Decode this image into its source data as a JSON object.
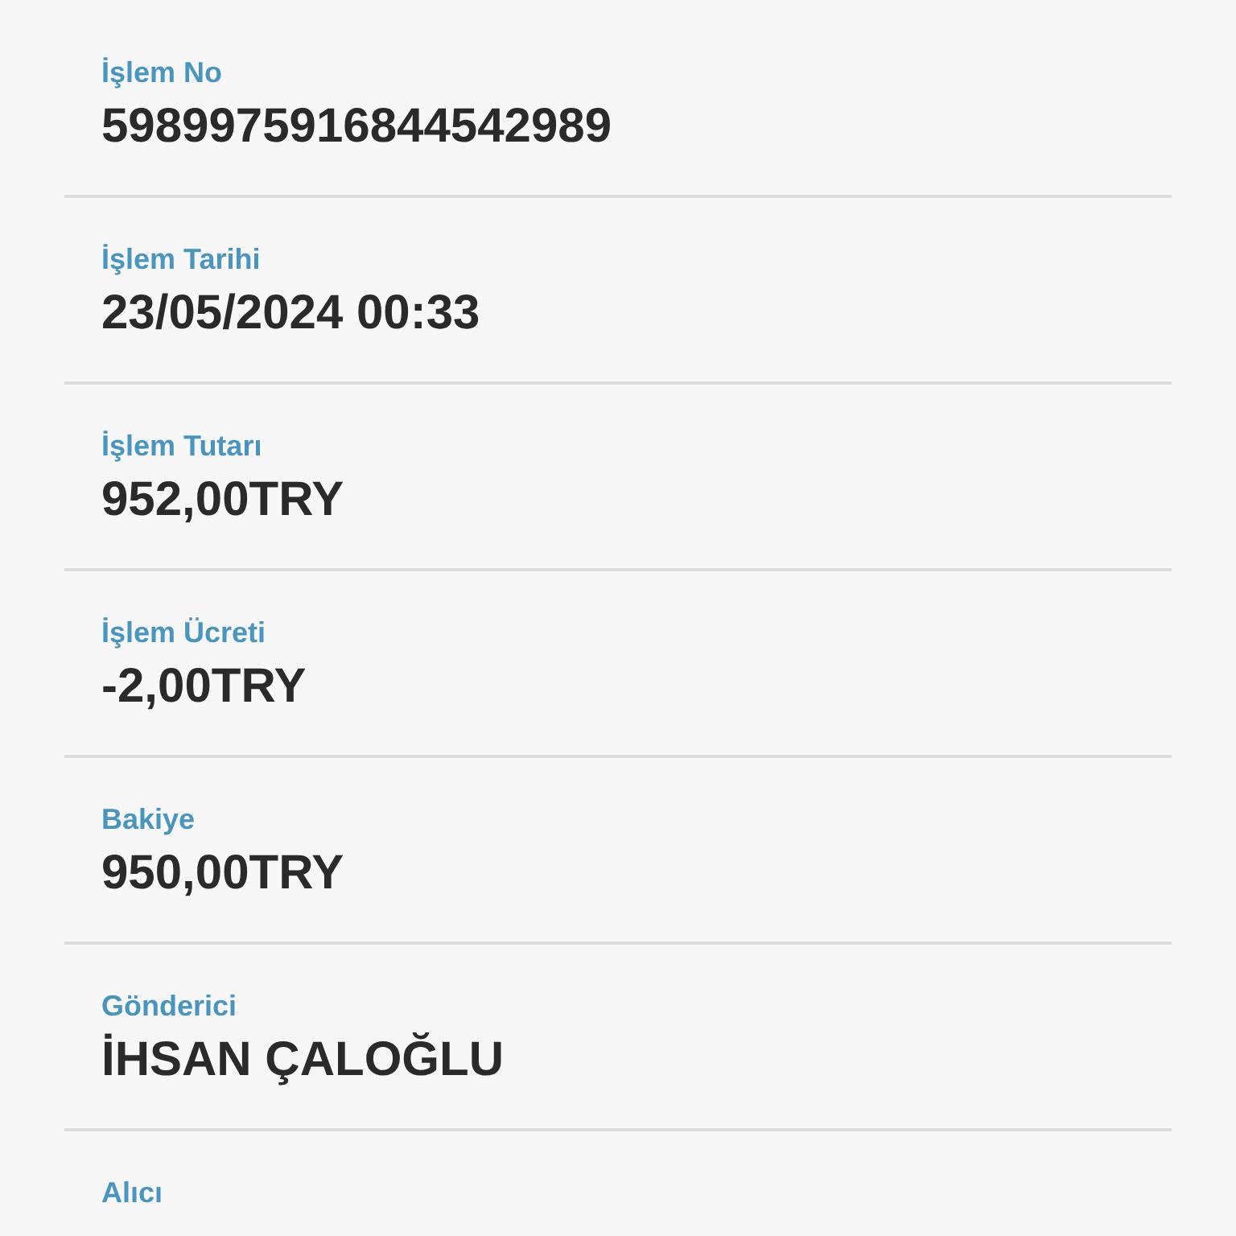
{
  "details": [
    {
      "label": "İşlem No",
      "value": "5989975916844542989"
    },
    {
      "label": "İşlem Tarihi",
      "value": "23/05/2024 00:33"
    },
    {
      "label": "İşlem Tutarı",
      "value": "952,00TRY"
    },
    {
      "label": "İşlem Ücreti",
      "value": "-2,00TRY"
    },
    {
      "label": "Bakiye",
      "value": "950,00TRY"
    },
    {
      "label": "Gönderici",
      "value": "İHSAN ÇALOĞLU"
    },
    {
      "label": "Alıcı"
    }
  ]
}
